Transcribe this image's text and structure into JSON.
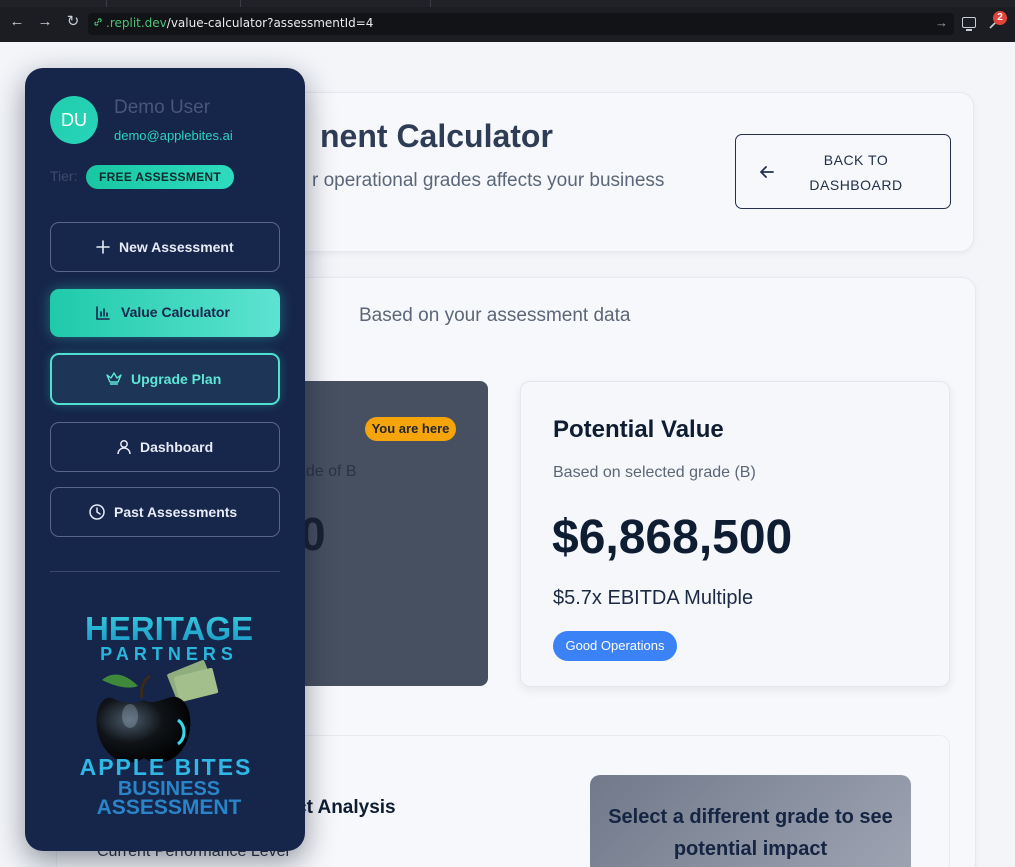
{
  "browser": {
    "url_domain": ".replit.dev",
    "url_path": "/value-calculator?assessmentId=4",
    "extension_badge": "2"
  },
  "sidebar": {
    "avatar_initials": "DU",
    "user_name": "Demo User",
    "user_email": "demo@applebites.ai",
    "tier_label": "Tier:",
    "tier_value": "FREE ASSESSMENT",
    "buttons": [
      {
        "label": "New Assessment",
        "icon": "plus-icon"
      },
      {
        "label": "Value Calculator",
        "icon": "chart-icon"
      },
      {
        "label": "Upgrade Plan",
        "icon": "crown-icon"
      },
      {
        "label": "Dashboard",
        "icon": "user-icon"
      },
      {
        "label": "Past Assessments",
        "icon": "clock-icon"
      }
    ],
    "logo": {
      "line1": "HERITAGE",
      "line2": "PARTNERS",
      "line3": "APPLE BITES",
      "line4": "BUSINESS",
      "line5": "ASSESSMENT"
    }
  },
  "header": {
    "title_visible": "nent Calculator",
    "subtitle_visible": "r operational grades affects your business",
    "back_button": "BACK TO DASHBOARD"
  },
  "main": {
    "based_on": "Based on your assessment data",
    "current": {
      "badge": "You are here",
      "grade_text_visible": "ade of B",
      "value_visible": "0"
    },
    "potential": {
      "title": "Potential Value",
      "subtitle": "Based on selected grade (B)",
      "value": "$6,868,500",
      "multiple": "$5.7x EBITDA Multiple",
      "badge": "Good Operations"
    },
    "analysis": {
      "title_visible": "ct Analysis",
      "performance_level": "Current Performance Level",
      "select_prompt": "Select a different grade to see potential impact"
    }
  },
  "colors": {
    "sidebar_bg": "#16254a",
    "accent_teal": "#2dd4bf",
    "badge_orange": "#f5a40c",
    "badge_blue": "#3b82f6"
  }
}
